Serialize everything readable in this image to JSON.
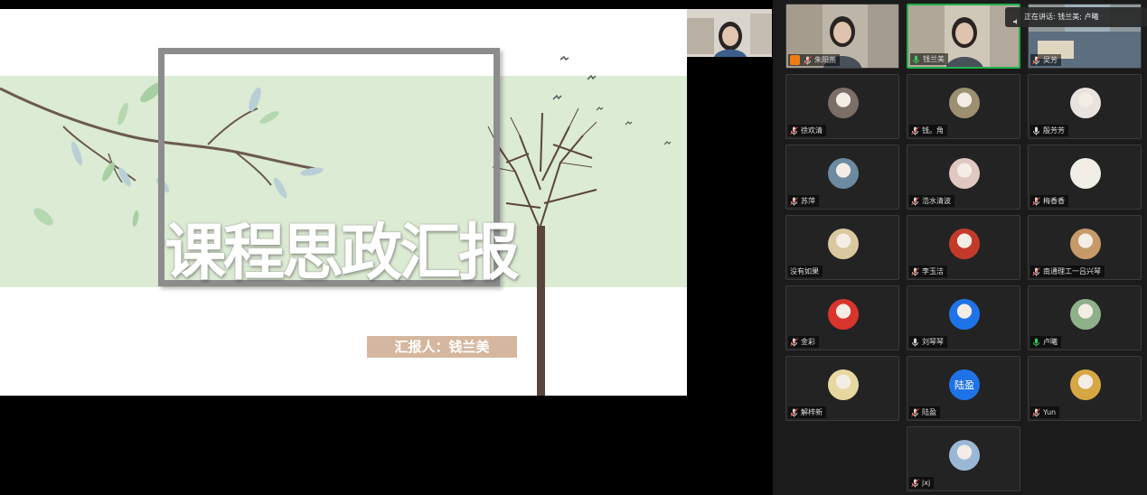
{
  "slide": {
    "title": "课程思政汇报",
    "reporter": "汇报人：钱兰美"
  },
  "speaking_banner": {
    "text": "正在讲话: 钱兰美; 卢曦"
  },
  "participants": [
    {
      "name": "朱阳燕",
      "kind": "video",
      "host": true,
      "mic": "muted"
    },
    {
      "name": "钱兰美",
      "kind": "video",
      "speaking": true,
      "mic": "active"
    },
    {
      "name": "吴芳",
      "kind": "video",
      "mic": "muted"
    },
    {
      "name": "徐欢清",
      "kind": "avatar",
      "mic": "muted"
    },
    {
      "name": "钱。角",
      "kind": "avatar",
      "mic": "muted"
    },
    {
      "name": "殷芳芳",
      "kind": "avatar",
      "mic": "normal"
    },
    {
      "name": "苏萍",
      "kind": "avatar",
      "mic": "muted"
    },
    {
      "name": "浩水清波",
      "kind": "avatar",
      "mic": "muted"
    },
    {
      "name": "梅香香",
      "kind": "avatar",
      "mic": "muted"
    },
    {
      "name": "没有如果",
      "kind": "avatar",
      "mic": "none"
    },
    {
      "name": "李玉洁",
      "kind": "avatar",
      "mic": "muted"
    },
    {
      "name": "南通理工一吕兴琴",
      "kind": "avatar",
      "mic": "muted"
    },
    {
      "name": "金彩",
      "kind": "avatar",
      "mic": "muted"
    },
    {
      "name": "刘琴琴",
      "kind": "avatar",
      "mic": "normal"
    },
    {
      "name": "卢曦",
      "kind": "avatar",
      "mic": "active"
    },
    {
      "name": "解梓新",
      "kind": "avatar",
      "mic": "muted"
    },
    {
      "name": "陆盈",
      "kind": "letter",
      "avatar_text": "陆盈",
      "mic": "muted"
    },
    {
      "name": "Yun",
      "kind": "avatar",
      "mic": "muted"
    },
    {
      "name": "jxj",
      "kind": "avatar",
      "mic": "muted"
    }
  ],
  "colors": {
    "slide_band": "#dcebd3",
    "reporter_bg": "#d5b79f",
    "speaking_border": "#22b14c",
    "host_badge": "#f07c13",
    "letter_avatar": "#1f73e8"
  }
}
